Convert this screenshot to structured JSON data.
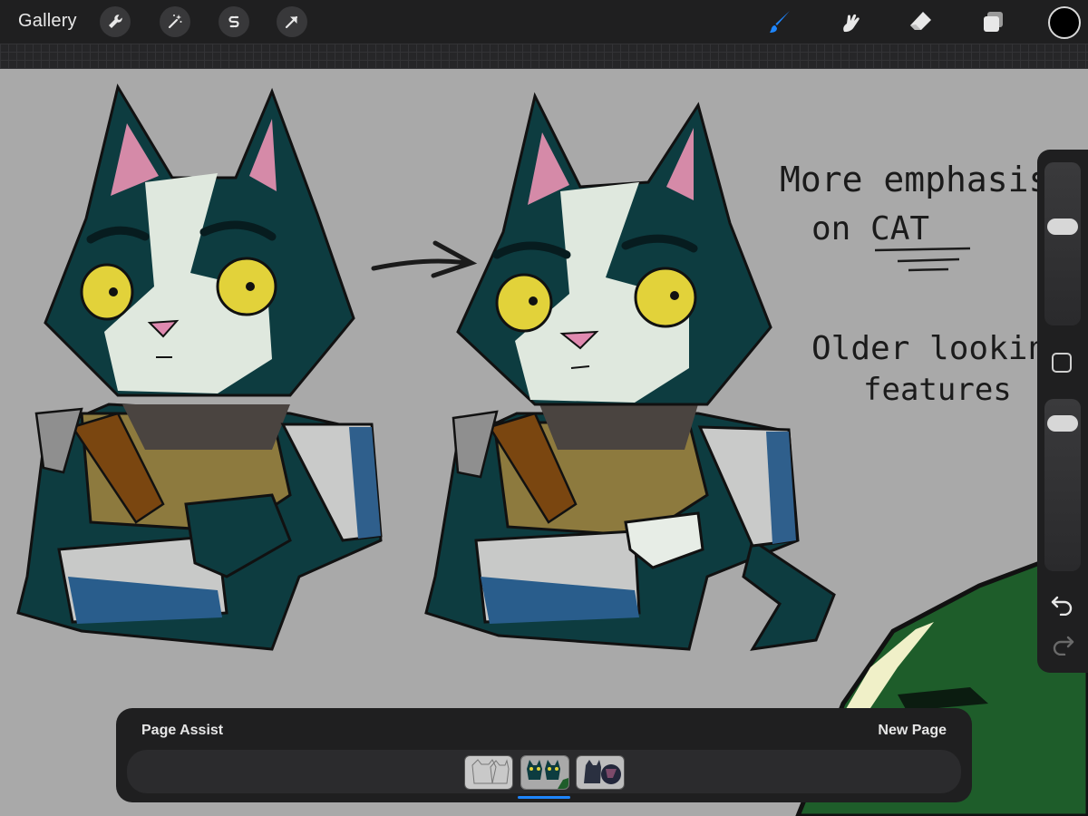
{
  "toolbar": {
    "gallery_label": "Gallery",
    "left_icons": [
      "wrench-icon",
      "magic-wand-icon",
      "selection-s-icon",
      "transform-arrow-icon"
    ],
    "right_icons": [
      "brush-icon",
      "smudge-icon",
      "eraser-icon",
      "layers-icon"
    ],
    "active_tool": "brush",
    "active_color": "#000000",
    "accent_color": "#1e86ff"
  },
  "canvas": {
    "notes": {
      "line1": "More emphasis",
      "line2": "on CAT",
      "line3": "Older looking",
      "line4": "features"
    }
  },
  "sidebar": {
    "controls": [
      "brush-size-slider",
      "modify-button",
      "opacity-slider",
      "undo-icon",
      "redo-icon"
    ]
  },
  "page_assist": {
    "title": "Page Assist",
    "new_page_label": "New Page",
    "pages_count": 3,
    "active_page": 2
  }
}
